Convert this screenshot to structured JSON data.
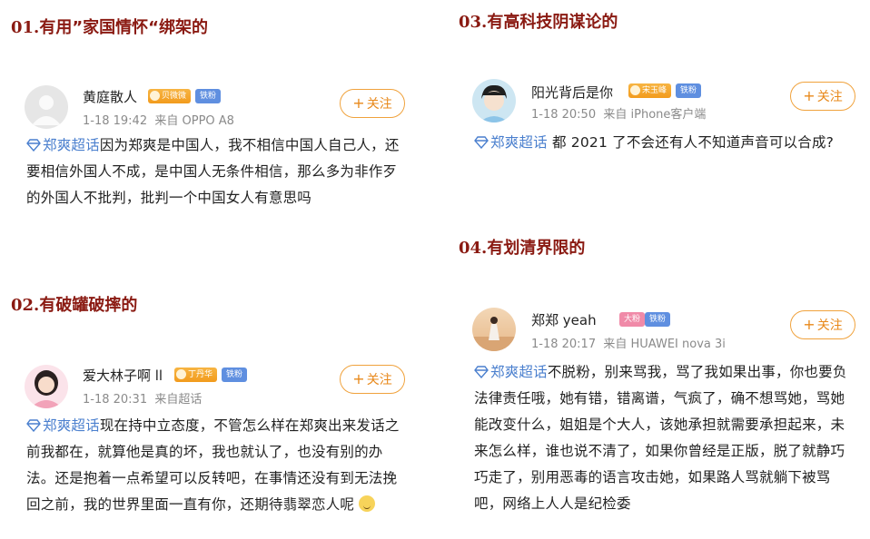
{
  "sections": {
    "s1": {
      "num": "01.",
      "title": "有用”家国情怀“绑架的"
    },
    "s2": {
      "num": "02.",
      "title": "有破罐破摔的"
    },
    "s3": {
      "num": "03.",
      "title": "有高科技阴谋论的"
    },
    "s4": {
      "num": "04.",
      "title": "有划清界限的"
    }
  },
  "follow_label": "关注",
  "fan_badge": "铁粉",
  "posts": [
    {
      "username": "黄庭散人",
      "badge": "贝微微",
      "time": "1-18 19:42",
      "source": "来自 OPPO A8",
      "topic": "郑爽超话",
      "text": "因为郑爽是中国人，我不相信中国人自己人，还要相信外国人不成，是中国人无条件相信，那么多为非作歹的外国人不批判，批判一个中国女人有意思吗"
    },
    {
      "username": "爱大林子啊 ll",
      "badge": "丁丹华",
      "time": "1-18 20:31",
      "source": "来自超话",
      "topic": "郑爽超话",
      "text": "现在持中立态度，不管怎么样在郑爽出来发话之前我都在，就算他是真的坏，我也就认了，也没有别的办法。还是抱着一点希望可以反转吧，在事情还没有到无法挽回之前，我的世界里面一直有你，还期待翡翠恋人呢"
    },
    {
      "username": "阳光背后是你",
      "badge": "宋玉峰",
      "time": "1-18 20:50",
      "source": "来自 iPhone客户端",
      "topic": "郑爽超话",
      "text": " 都 2021 了不会还有人不知道声音可以合成?"
    },
    {
      "username": "郑郑 yeah",
      "badge": "大粉",
      "time": "1-18 20:17",
      "source": "来自 HUAWEI nova 3i",
      "topic": "郑爽超话",
      "text": "不脱粉，别来骂我，骂了我如果出事，你也要负法律责任哦，她有错，错离谱，气疯了，确不想骂她，骂她能改变什么，姐姐是个大人，该她承担就需要承担起来，未来怎么样，谁也说不清了，如果你曾经是正版，脱了就静巧巧走了，别用恶毒的语言攻击她，如果路人骂就躺下被骂吧，网络上人人是纪检委"
    }
  ],
  "colors": {
    "title": "#8a1a12",
    "topic": "#4a7fce",
    "follow": "#e8881a",
    "fan": "#5f8fe0",
    "meta": "#8a8a8a"
  }
}
